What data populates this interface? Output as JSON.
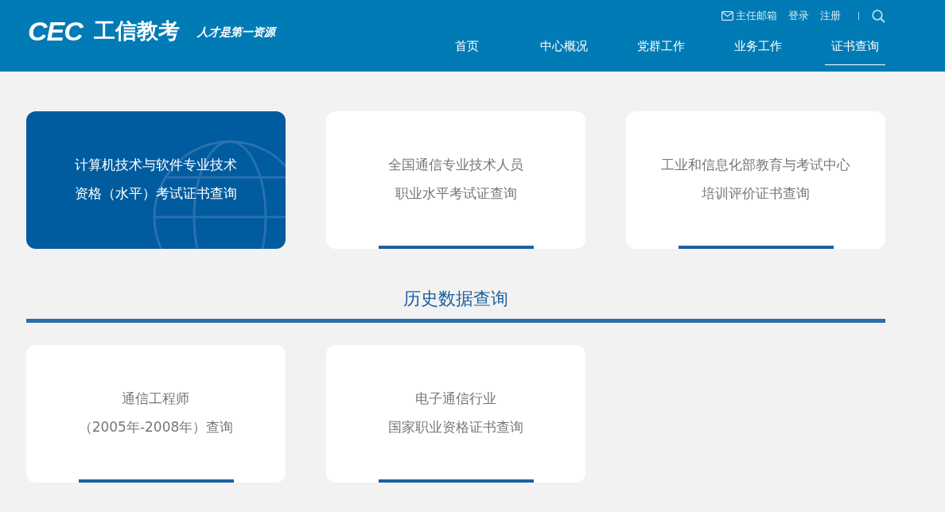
{
  "header": {
    "logo": "CEC",
    "brand": "工信教考",
    "slogan": "人才是第一资源",
    "top_links": [
      {
        "kind": "mail",
        "label": "主任邮箱"
      },
      {
        "kind": "plain",
        "label": "登录"
      },
      {
        "kind": "plain",
        "label": "注册"
      }
    ],
    "nav": [
      {
        "label": "首页",
        "selected": false
      },
      {
        "label": "中心概况",
        "selected": false
      },
      {
        "label": "党群工作",
        "selected": false
      },
      {
        "label": "业务工作",
        "selected": false
      },
      {
        "label": "证书查询",
        "selected": true
      }
    ]
  },
  "cards": [
    {
      "lines": [
        "计算机技术与软件专业技术",
        "资格（水平）考试证书查询"
      ],
      "selected": true
    },
    {
      "lines": [
        "全国通信专业技术人员",
        "职业水平考试证查询"
      ],
      "selected": false
    },
    {
      "lines": [
        "工业和信息化部教育与考试中心",
        "培训评价证书查询"
      ],
      "selected": false
    }
  ],
  "history": {
    "title": "历史数据查询",
    "cards": [
      {
        "lines": [
          "通信工程师",
          "（2005年-2008年）查询"
        ],
        "selected": false
      },
      {
        "lines": [
          "电子通信行业",
          "国家职业资格证书查询"
        ],
        "selected": false
      }
    ]
  }
}
